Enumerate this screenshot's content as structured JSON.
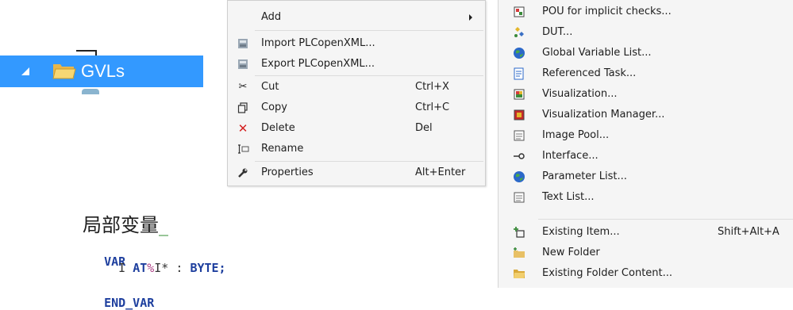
{
  "tree": {
    "node_label": "GVLs",
    "expand_icon": "expanded-triangle-icon",
    "folder_icon": "folder-open-icon"
  },
  "context_menu": {
    "items": [
      {
        "label": "Add",
        "shortcut": "",
        "icon": "none",
        "has_submenu": true
      },
      {
        "label": "Import PLCopenXML...",
        "shortcut": "",
        "icon": "import-icon"
      },
      {
        "label": "Export PLCopenXML...",
        "shortcut": "",
        "icon": "export-icon"
      },
      {
        "label": "Cut",
        "shortcut": "Ctrl+X",
        "icon": "scissors-icon"
      },
      {
        "label": "Copy",
        "shortcut": "Ctrl+C",
        "icon": "copy-icon"
      },
      {
        "label": "Delete",
        "shortcut": "Del",
        "icon": "delete-x-icon"
      },
      {
        "label": "Rename",
        "shortcut": "",
        "icon": "rename-icon"
      },
      {
        "label": "Properties",
        "shortcut": "Alt+Enter",
        "icon": "wrench-icon"
      }
    ]
  },
  "submenu": {
    "items": [
      {
        "label": "POU for implicit checks...",
        "shortcut": "",
        "icon": "pou-icon"
      },
      {
        "label": "DUT...",
        "shortcut": "",
        "icon": "dut-icon"
      },
      {
        "label": "Global Variable List...",
        "shortcut": "",
        "icon": "globe-icon"
      },
      {
        "label": "Referenced Task...",
        "shortcut": "",
        "icon": "referenced-task-icon"
      },
      {
        "label": "Visualization...",
        "shortcut": "",
        "icon": "visualization-icon"
      },
      {
        "label": "Visualization Manager...",
        "shortcut": "",
        "icon": "visualization-manager-icon"
      },
      {
        "label": "Image Pool...",
        "shortcut": "",
        "icon": "image-pool-icon"
      },
      {
        "label": "Interface...",
        "shortcut": "",
        "icon": "interface-icon"
      },
      {
        "label": "Parameter List...",
        "shortcut": "",
        "icon": "globe-icon"
      },
      {
        "label": "Text List...",
        "shortcut": "",
        "icon": "text-list-icon"
      },
      {
        "label": "Existing Item...",
        "shortcut": "Shift+Alt+A",
        "icon": "existing-item-icon"
      },
      {
        "label": "New Folder",
        "shortcut": "",
        "icon": "new-folder-icon"
      },
      {
        "label": "Existing Folder Content...",
        "shortcut": "",
        "icon": "folder-icon"
      }
    ]
  },
  "code": {
    "heading": "局部变量",
    "heading_cursor": "_",
    "line1": "VAR",
    "line2_var": "I",
    "line2_at": "AT",
    "line2_pct": "%",
    "line2_addr": "I*",
    "line2_colon": ":",
    "line2_type": "BYTE;",
    "line3": "END_VAR"
  },
  "colors": {
    "selection": "#3399ff",
    "keyword": "#1e3f9e",
    "menu_bg": "#f5f5f5",
    "delete_red": "#d42020"
  }
}
